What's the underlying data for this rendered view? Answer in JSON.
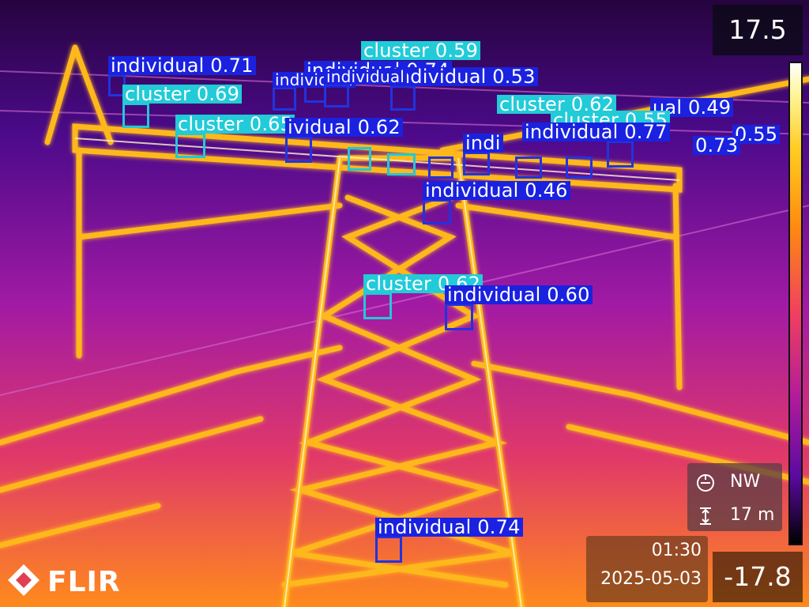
{
  "overlay": {
    "temp_max": "17.5",
    "temp_min": "-17.8",
    "heading": "NW",
    "distance": "17 m",
    "time": "01:30",
    "date": "2025-05-03",
    "brand": "FLIR",
    "icons": [
      "compass-icon",
      "distance-icon",
      "flir-logo-icon"
    ]
  },
  "detections": [
    {
      "label": "individual 0.71",
      "cls": "individual"
    },
    {
      "label": "cluster 0.59",
      "cls": "cluster"
    },
    {
      "label": "individual 0.74",
      "cls": "individual"
    },
    {
      "label": "individual 0.53",
      "cls": "individual"
    },
    {
      "label": "cluster 0.69",
      "cls": "cluster"
    },
    {
      "label": "individual",
      "cls": "individual"
    },
    {
      "label": "individual",
      "cls": "individual"
    },
    {
      "label": "cluster 0.62",
      "cls": "cluster"
    },
    {
      "label": "ual 0.49",
      "cls": "individual"
    },
    {
      "label": "cluster 0.65",
      "cls": "cluster"
    },
    {
      "label": "ividual 0.62",
      "cls": "individual"
    },
    {
      "label": "cluster 0.55",
      "cls": "cluster"
    },
    {
      "label": "0.55",
      "cls": "individual"
    },
    {
      "label": "individual 0.77",
      "cls": "individual"
    },
    {
      "label": "0.73",
      "cls": "individual"
    },
    {
      "label": "indi",
      "cls": "individual"
    },
    {
      "label": "individual 0.46",
      "cls": "individual"
    },
    {
      "label": "cluster 0.62",
      "cls": "cluster"
    },
    {
      "label": "individual 0.60",
      "cls": "individual"
    },
    {
      "label": "individual 0.74",
      "cls": "individual"
    }
  ]
}
